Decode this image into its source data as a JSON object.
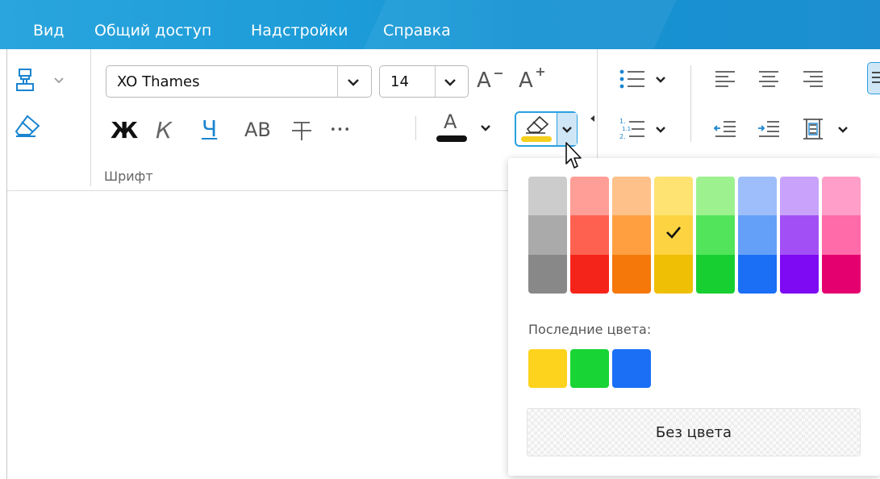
{
  "menu": {
    "items": [
      {
        "label": "Вид"
      },
      {
        "label": "Общий доступ"
      },
      {
        "label": "Надстройки"
      },
      {
        "label": "Справка"
      }
    ]
  },
  "toolbar": {
    "font_name": "XO Thames",
    "font_size": "14",
    "grow_font": "A",
    "shrink_font": "A",
    "bold": "Ж",
    "italic": "К",
    "underline": "Ч",
    "caps": "АВ",
    "more": "•••",
    "font_color": "A",
    "group_label": "Шрифт"
  },
  "colors": {
    "accent": "#1a9ad7",
    "highlight_selected": "#f5cf1e",
    "text_color": "#111111"
  },
  "color_picker": {
    "palette": [
      [
        "#cccccc",
        "#aaaaaa",
        "#888888"
      ],
      [
        "#ff9e96",
        "#ff6150",
        "#f5241a"
      ],
      [
        "#ffc18a",
        "#ff9f3f",
        "#f5780a"
      ],
      [
        "#ffe372",
        "#fdd341",
        "#efbf06"
      ],
      [
        "#9df28f",
        "#52e45a",
        "#18cf32"
      ],
      [
        "#9dbefa",
        "#65a0f8",
        "#1a6ff5"
      ],
      [
        "#c8a2fb",
        "#a250f6",
        "#7d0af3"
      ],
      [
        "#ff9ec8",
        "#ff6aa8",
        "#e4006e"
      ]
    ],
    "selected": "#fdd341",
    "recent_label": "Последние цвета:",
    "recent": [
      "#fdd31e",
      "#18d434",
      "#1a6ff5"
    ],
    "no_color_label": "Без цвета"
  }
}
